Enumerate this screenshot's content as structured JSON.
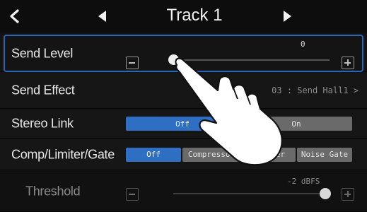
{
  "header": {
    "title": "Track 1",
    "back_icon": "back-chevron-icon",
    "prev_icon": "triangle-left-icon",
    "next_icon": "triangle-right-icon"
  },
  "rows": {
    "send_level": {
      "label": "Send Level",
      "value": "0",
      "slider_fraction": 0.0
    },
    "send_effect": {
      "label": "Send Effect",
      "value": "03 : Send Hall1 >"
    },
    "stereo_link": {
      "label": "Stereo Link",
      "options": [
        "Off",
        "On"
      ],
      "selected": "Off"
    },
    "comp_limiter_gate": {
      "label": "Comp/Limiter/Gate",
      "options": [
        "Off",
        "Compressor",
        "Limiter",
        "Noise Gate"
      ],
      "selected": "Off"
    },
    "threshold": {
      "label": "Threshold",
      "value": "-2 dBFS",
      "slider_fraction": 0.97
    }
  },
  "colors": {
    "accent": "#2e6fc4",
    "focus_outline": "#2b66b8",
    "inactive": "#6a6a6a",
    "background": "#121212"
  },
  "icons": {
    "minus": "minus-box-icon",
    "plus": "plus-box-icon",
    "pointer": "hand-pointer-icon"
  }
}
